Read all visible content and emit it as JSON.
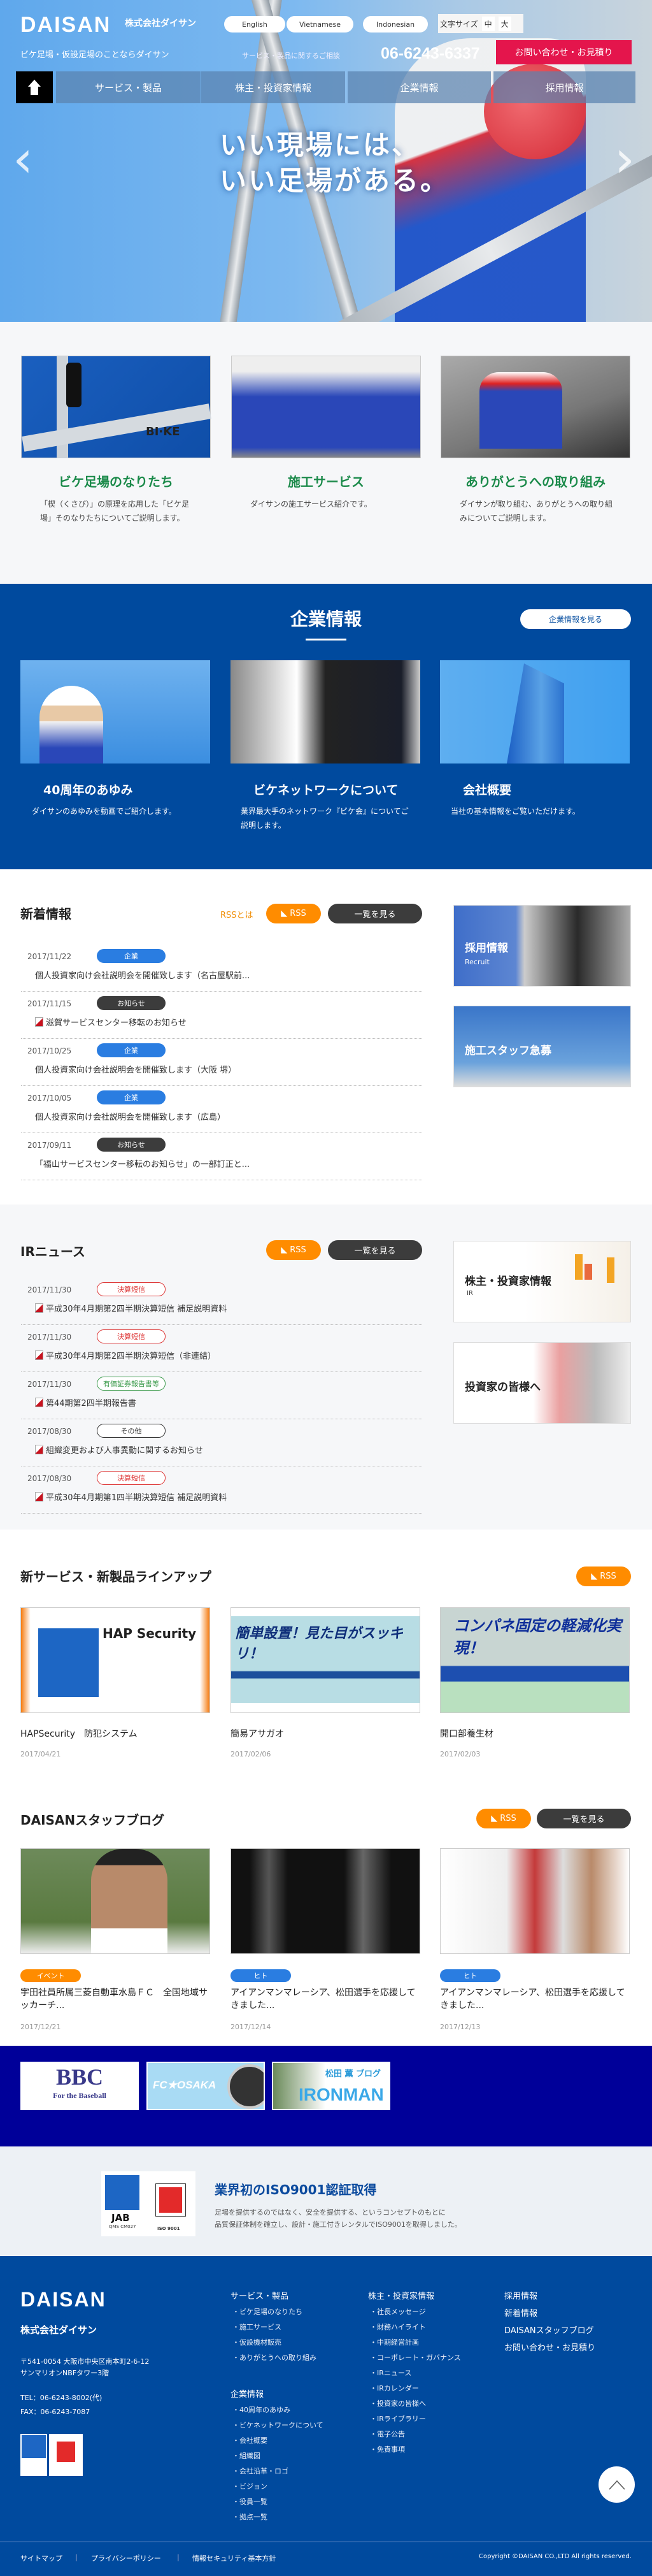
{
  "header": {
    "logo": "DAISAN",
    "logo_sub": "株式会社ダイサン",
    "languages": [
      "English",
      "Vietnamese",
      "Indonesian"
    ],
    "font_size_label": "文字サイズ",
    "font_sizes": [
      "中",
      "大"
    ],
    "tagline": "ビケ足場・仮設足場のことならダイサン",
    "phone_label": "サービス・製品に関するご相談",
    "phone": "06-6243-6337",
    "contact_button": "お問い合わせ・お見積り",
    "nav": [
      "サービス・製品",
      "株主・投資家情報",
      "企業情報",
      "採用情報"
    ]
  },
  "hero": {
    "copy_line1": "いい現場には、",
    "copy_line2": "いい足場がある。"
  },
  "features": [
    {
      "title": "ビケ足場のなりたち",
      "desc": "「楔（くさび）」の原理を応用した「ビケ足場」そのなりたちについてご説明します。",
      "image_text": "BI·KE"
    },
    {
      "title": "施工サービス",
      "desc": "ダイサンの施工サービス紹介です。"
    },
    {
      "title": "ありがとうへの取り組み",
      "desc": "ダイサンが取り組む、ありがとうへの取り組みについてご説明します。"
    }
  ],
  "corporate": {
    "title": "企業情報",
    "button": "企業情報を見る",
    "cards": [
      {
        "title": "40周年のあゆみ",
        "desc": "ダイサンのあゆみを動画でご紹介します。"
      },
      {
        "title": "ビケネットワークについて",
        "desc": "業界最大手のネットワーク『ビケ会』についてご説明します。"
      },
      {
        "title": "会社概要",
        "desc": "当社の基本情報をご覧いただけます。"
      }
    ]
  },
  "news": {
    "title": "新着情報",
    "rss_about": "RSSとは",
    "rss": "RSS",
    "list_button": "一覧を見る",
    "items": [
      {
        "date": "2017/11/22",
        "tag": "企業",
        "text": "個人投資家向け会社説明会を開催致します（名古屋駅前..."
      },
      {
        "date": "2017/11/15",
        "tag": "お知らせ",
        "text": "滋賀サービスセンター移転のお知らせ",
        "pdf": true
      },
      {
        "date": "2017/10/25",
        "tag": "企業",
        "text": "個人投資家向け会社説明会を開催致します（大阪 堺）"
      },
      {
        "date": "2017/10/05",
        "tag": "企業",
        "text": "個人投資家向け会社説明会を開催致します（広島）"
      },
      {
        "date": "2017/09/11",
        "tag": "お知らせ",
        "text": "「福山サービスセンター移転のお知らせ」の一部訂正と..."
      }
    ],
    "side_banners": [
      {
        "title": "採用情報",
        "sub": "Recruit"
      },
      {
        "title": "施工スタッフ急募"
      }
    ]
  },
  "ir": {
    "title": "IRニュース",
    "rss": "RSS",
    "list_button": "一覧を見る",
    "items": [
      {
        "date": "2017/11/30",
        "tag": "決算短信",
        "text": "平成30年4月期第2四半期決算短信 補足説明資料"
      },
      {
        "date": "2017/11/30",
        "tag": "決算短信",
        "text": "平成30年4月期第2四半期決算短信（非連結）"
      },
      {
        "date": "2017/11/30",
        "tag": "有価証券報告書等",
        "text": "第44期第2四半期報告書"
      },
      {
        "date": "2017/08/30",
        "tag": "その他",
        "text": "組織変更および人事異動に関するお知らせ"
      },
      {
        "date": "2017/08/30",
        "tag": "決算短信",
        "text": "平成30年4月期第1四半期決算短信 補足説明資料"
      }
    ],
    "side_banners": [
      {
        "title": "株主・投資家情報",
        "sub": "IR"
      },
      {
        "title": "投資家の皆様へ"
      }
    ]
  },
  "products": {
    "title": "新サービス・新製品ラインアップ",
    "rss": "RSS",
    "items": [
      {
        "title": "HAPSecurity　防犯システム",
        "date": "2017/04/21",
        "image_text": "HAP Security"
      },
      {
        "title": "簡易アサガオ",
        "date": "2017/02/06",
        "image_text": "簡単設置！見た目がスッキリ！"
      },
      {
        "title": "開口部養生材",
        "date": "2017/02/03",
        "image_text": "コンパネ固定の軽減化実現！"
      }
    ]
  },
  "blog": {
    "title": "DAISANスタッフブログ",
    "rss": "RSS",
    "list_button": "一覧を見る",
    "items": [
      {
        "tag": "イベント",
        "title": "宇田社員所属三菱自動車水島ＦＣ　全国地域サッカーチ...",
        "date": "2017/12/21"
      },
      {
        "tag": "ヒト",
        "title": "アイアンマンマレーシア、松田選手を応援してきました...",
        "date": "2017/12/14"
      },
      {
        "tag": "ヒト",
        "title": "アイアンマンマレーシア、松田選手を応援してきました...",
        "date": "2017/12/13"
      }
    ]
  },
  "banners": [
    {
      "title": "BBC",
      "sub": "For the Baseball"
    },
    {
      "title": "FC★OSAKA"
    },
    {
      "title": "IRONMAN",
      "sub": "松田 薫 ブログ"
    }
  ],
  "iso": {
    "title": "業界初のISO9001認証取得",
    "line1": "足場を提供するのではなく、安全を提供する、というコンセプトのもとに",
    "line2": "品質保証体制を確立し、設計・施工付きレンタルでISO9001を取得しました。",
    "logo_text": [
      "JAB",
      "QMS CM027",
      "ISO 9001"
    ]
  },
  "footer": {
    "logo": "DAISAN",
    "logo_sub": "株式会社ダイサン",
    "address1": "〒541-0054 大阪市中央区南本町2-6-12",
    "address2": "サンマリオンNBFタワー3階",
    "tel": "TEL：06-6243-8002(代)",
    "fax": "FAX：06-6243-7087",
    "col_services": {
      "title": "サービス・製品",
      "items": [
        "ビケ足場のなりたち",
        "施工サービス",
        "仮設機材販売",
        "ありがとうへの取り組み"
      ]
    },
    "col_corporate": {
      "title": "企業情報",
      "items": [
        "40周年のあゆみ",
        "ビケネットワークについて",
        "会社概要",
        "組織図",
        "会社沿革・ロゴ",
        "ビジョン",
        "役員一覧",
        "拠点一覧"
      ]
    },
    "col_ir": {
      "title": "株主・投資家情報",
      "items": [
        "社長メッセージ",
        "財務ハイライト",
        "中期経営計画",
        "コーポレート・ガバナンス",
        "IRニュース",
        "IRカレンダー",
        "投資家の皆様へ",
        "IRライブラリー",
        "電子公告",
        "免責事項"
      ]
    },
    "col_other": [
      "採用情報",
      "新着情報",
      "DAISANスタッフブログ",
      "お問い合わせ・お見積り"
    ],
    "bottom_links": [
      "サイトマップ",
      "プライバシーポリシー",
      "情報セキュリティ基本方針"
    ],
    "copyright": "Copyright ©DAISAN CO.,LTD All rights reserved."
  },
  "colors": {
    "brand_blue": "#004a9e",
    "contact_red": "#e4154c",
    "rss_orange": "#ff8c00",
    "feature_green": "#1b8a4a",
    "tag_blue": "#2a7de1",
    "banner_navy": "#000099"
  }
}
